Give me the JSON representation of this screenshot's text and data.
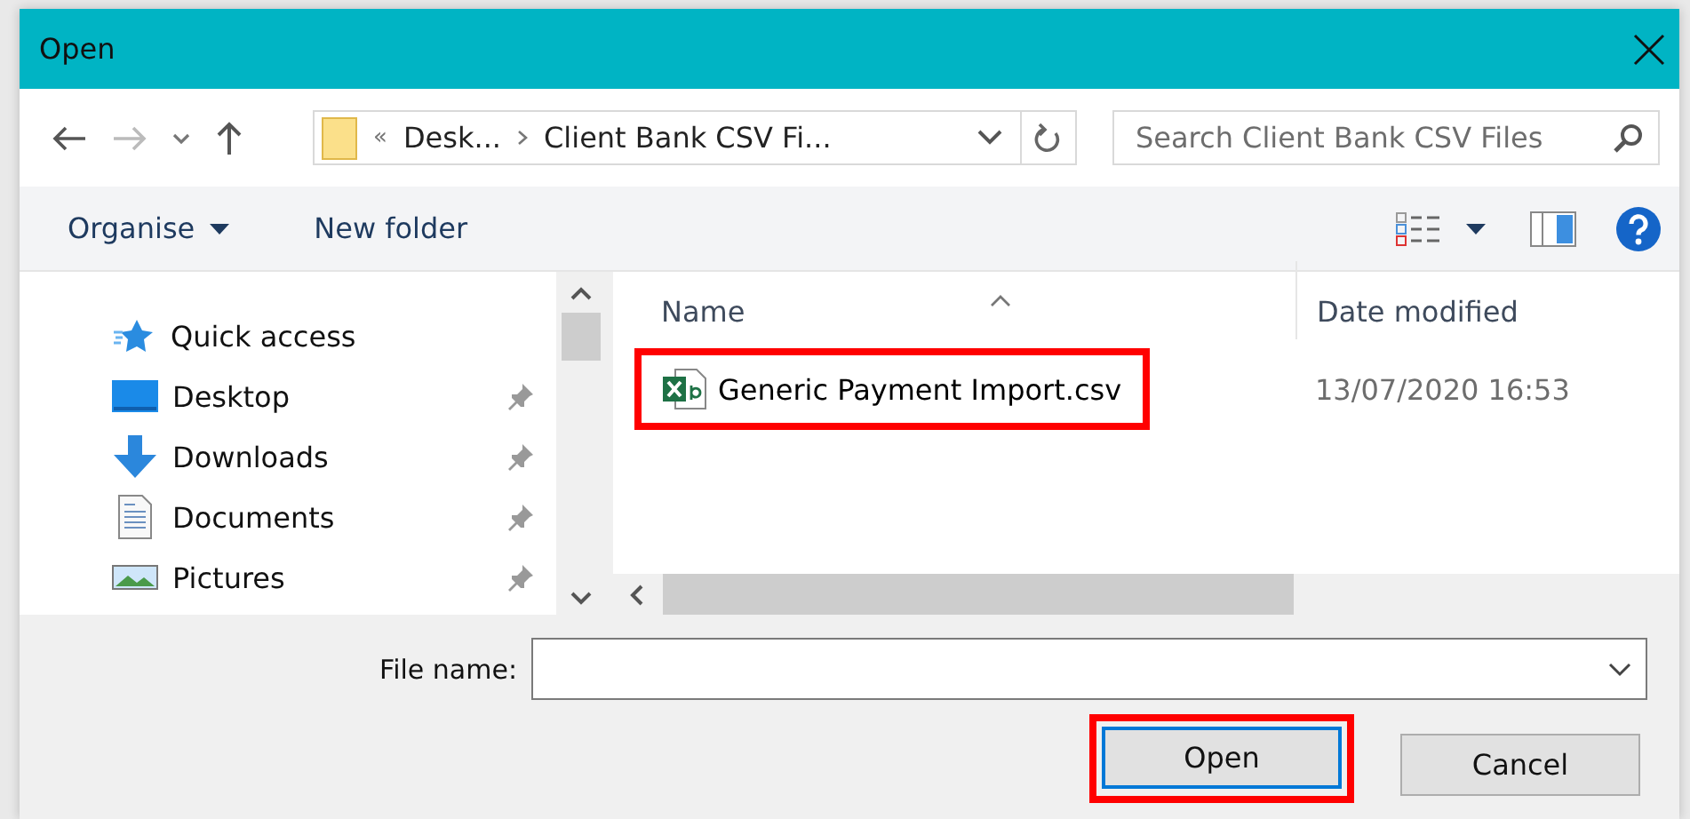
{
  "window": {
    "title": "Open"
  },
  "address_bar": {
    "overflow": "«",
    "path": [
      "Desk...",
      "Client Bank CSV Fi..."
    ]
  },
  "search": {
    "placeholder": "Search Client Bank CSV Files"
  },
  "toolbar": {
    "buttons": [
      {
        "label": "Organise",
        "has_menu": true
      },
      {
        "label": "New folder",
        "has_menu": false
      }
    ]
  },
  "navigation": {
    "items": [
      {
        "label": "Quick access",
        "kind": "star",
        "pinned": false
      },
      {
        "label": "Desktop",
        "kind": "desktop",
        "pinned": true
      },
      {
        "label": "Downloads",
        "kind": "download",
        "pinned": true
      },
      {
        "label": "Documents",
        "kind": "document",
        "pinned": true
      },
      {
        "label": "Pictures",
        "kind": "picture",
        "pinned": true
      }
    ]
  },
  "files": {
    "columns": [
      "Name",
      "Date modified"
    ],
    "rows": [
      {
        "name": "Generic Payment Import.csv",
        "date_modified": "13/07/2020 16:53",
        "highlighted": true
      }
    ]
  },
  "footer": {
    "file_name_label": "File name:",
    "buttons": [
      {
        "label": "Open",
        "default": true,
        "highlighted": true
      },
      {
        "label": "Cancel",
        "default": false,
        "highlighted": false
      }
    ]
  }
}
